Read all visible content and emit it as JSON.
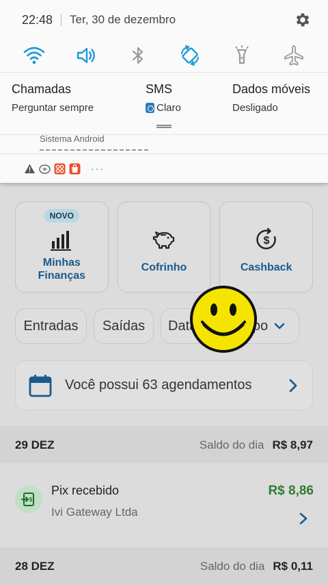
{
  "status_bar": {
    "time": "22:48",
    "date": "Ter, 30 de dezembro"
  },
  "quick_settings": {
    "tiles": [
      {
        "name": "wifi",
        "icon": "wifi-icon",
        "active": true
      },
      {
        "name": "sound",
        "icon": "volume-icon",
        "active": true
      },
      {
        "name": "bluetooth",
        "icon": "bluetooth-icon",
        "active": false
      },
      {
        "name": "auto-rotate",
        "icon": "rotate-icon",
        "active": true
      },
      {
        "name": "flashlight",
        "icon": "flashlight-icon",
        "active": false
      },
      {
        "name": "airplane",
        "icon": "airplane-icon",
        "active": false
      }
    ],
    "active_color": "#1e9ad6",
    "inactive_color": "#9a9a9a"
  },
  "sim_settings": {
    "calls": {
      "title": "Chamadas",
      "value": "Perguntar sempre"
    },
    "sms": {
      "title": "SMS",
      "value": "Claro"
    },
    "data": {
      "title": "Dados móveis",
      "value": "Desligado"
    }
  },
  "notification": {
    "source": "Sistema Android"
  },
  "app": {
    "tiles": [
      {
        "label_line1": "Minhas",
        "label_line2": "Finanças",
        "badge": "NOVO",
        "icon": "bar-chart-icon"
      },
      {
        "label": "Cofrinho",
        "icon": "piggy-bank-icon"
      },
      {
        "label": "Cashback",
        "icon": "cashback-icon"
      }
    ],
    "filters": {
      "entradas": "Entradas",
      "saidas": "Saídas",
      "data": "Data",
      "tipo": "Tipo"
    },
    "schedule": {
      "text": "Você possui 63 agendamentos"
    },
    "days": [
      {
        "date": "29 DEZ",
        "saldo_label": "Saldo do dia",
        "saldo": "R$ 8,97"
      },
      {
        "date": "28 DEZ",
        "saldo_label": "Saldo do dia",
        "saldo": "R$ 0,11"
      }
    ],
    "transaction": {
      "title": "Pix recebido",
      "subtitle": "Ivi Gateway Ltda",
      "amount": "R$ 8,86"
    },
    "accent_color": "#1a5a8c",
    "positive_color": "#2e7d32"
  }
}
